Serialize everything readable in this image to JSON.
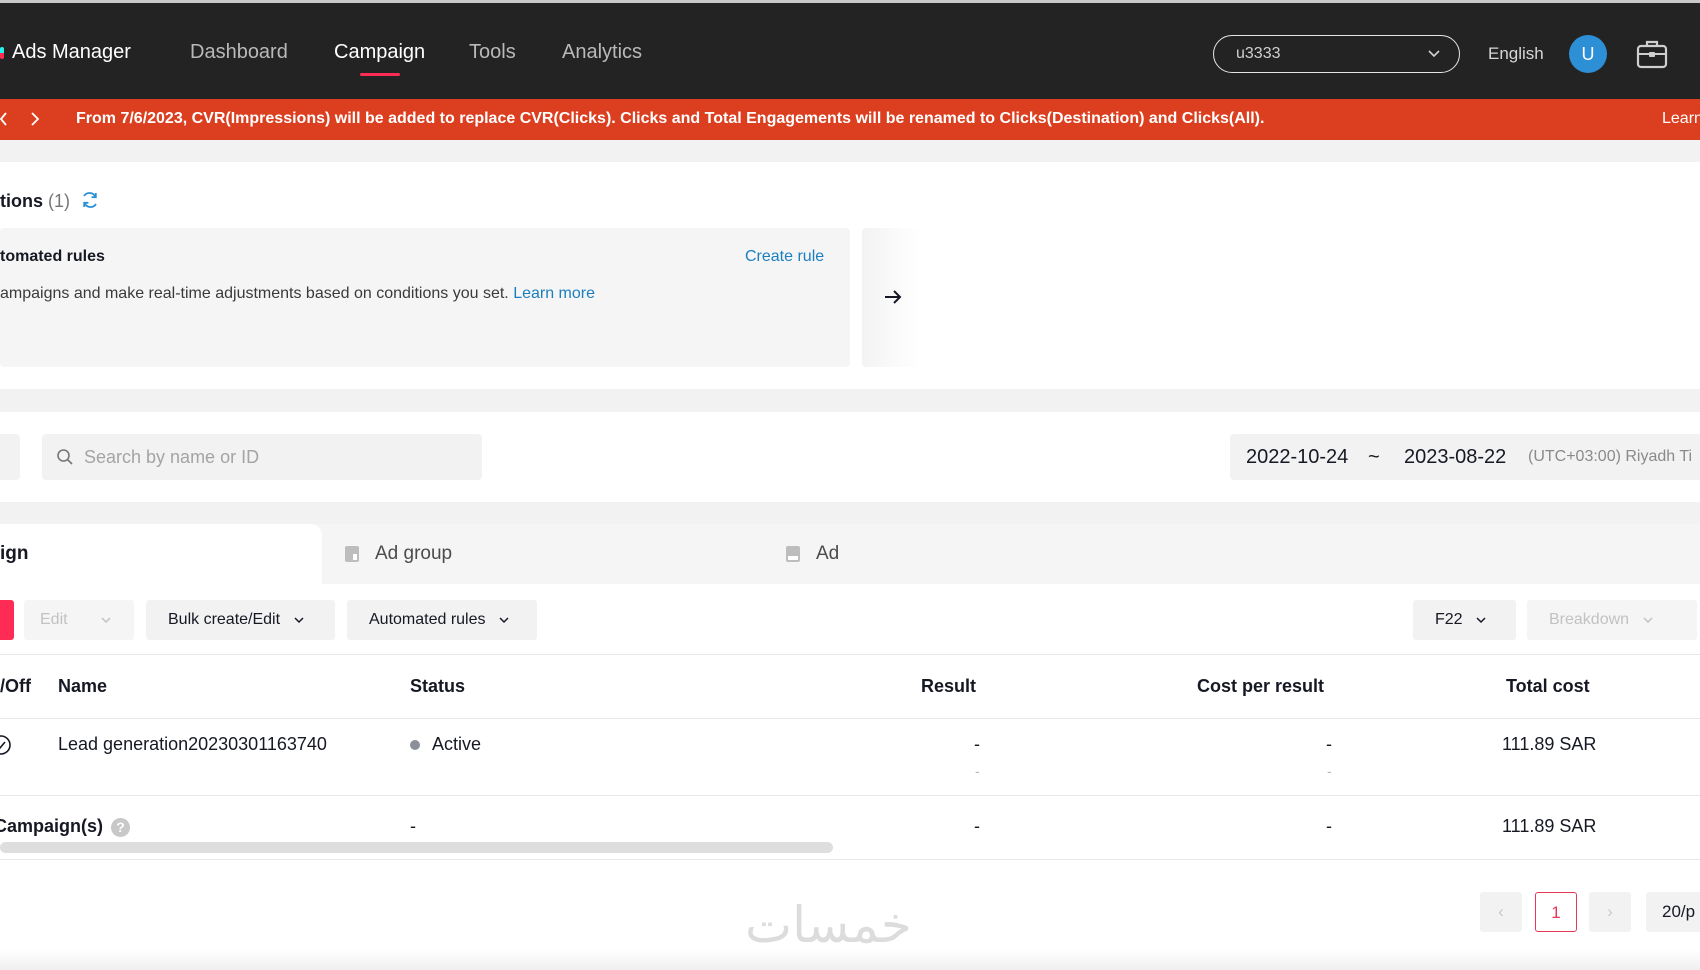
{
  "nav": {
    "brand": "Ads Manager",
    "items": [
      {
        "label": "Dashboard",
        "active": false
      },
      {
        "label": "Campaign",
        "active": true
      },
      {
        "label": "Tools",
        "active": false
      },
      {
        "label": "Analytics",
        "active": false
      }
    ],
    "account_select": "u3333",
    "language": "English",
    "avatar_initial": "U",
    "colors": {
      "accent": "#fe2c55",
      "avatar": "#2d8fd5",
      "banner": "#dc3f1f",
      "link": "#1b7fbf"
    }
  },
  "banner": {
    "message": "From 7/6/2023, CVR(Impressions) will be added to replace CVR(Clicks). Clicks and Total Engagements will be renamed to Clicks(Destination) and Clicks(All).",
    "learn_more": "Learn"
  },
  "suggestions": {
    "title": "tions",
    "count": "(1)",
    "card": {
      "title": "tomated rules",
      "create_label": "Create rule",
      "description": "ampaigns and make real-time adjustments based on conditions you set.",
      "learn_more": "Learn more"
    }
  },
  "filters": {
    "search_placeholder": "Search by name or ID",
    "date_start": "2022-10-24",
    "date_separator": "~",
    "date_end": "2023-08-22",
    "timezone": "(UTC+03:00) Riyadh Ti"
  },
  "tabs": [
    {
      "label": "ign",
      "active": true
    },
    {
      "label": "Ad group",
      "active": false
    },
    {
      "label": "Ad",
      "active": false
    }
  ],
  "toolbar": {
    "edit": "Edit",
    "bulk": "Bulk create/Edit",
    "rules": "Automated rules",
    "column_preset": "F22",
    "breakdown": "Breakdown"
  },
  "table": {
    "columns": [
      "/Off",
      "Name",
      "Status",
      "Result",
      "Cost per result",
      "Total cost"
    ],
    "rows": [
      {
        "name": "Lead generation20230301163740",
        "status": "Active",
        "result": "-",
        "result_sub": "-",
        "cpr": "-",
        "cpr_sub": "-",
        "total": "111.89 SAR"
      }
    ],
    "total_row": {
      "label": "Campaign(s)",
      "status": "-",
      "result": "-",
      "cpr": "-",
      "total": "111.89 SAR"
    }
  },
  "pagination": {
    "current": "1",
    "page_size": "20/p"
  },
  "watermark": "خمسات"
}
